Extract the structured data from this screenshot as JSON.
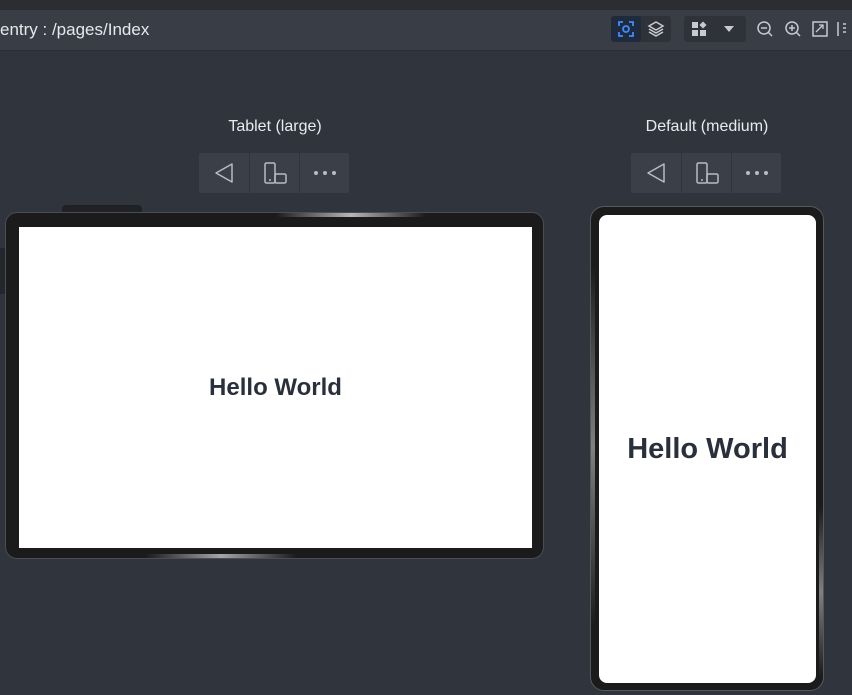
{
  "toolbar": {
    "title": "entry : /pages/Index"
  },
  "devices": {
    "tablet": {
      "label": "Tablet (large)",
      "content": "Hello World"
    },
    "default": {
      "label": "Default (medium)",
      "content": "Hello World"
    }
  },
  "icons": {
    "toolbar": [
      "inspect-icon",
      "layers-icon",
      "components-icon",
      "dropdown-icon",
      "zoom-out-icon",
      "zoom-in-icon",
      "fit-screen-icon",
      "ruler-icon"
    ],
    "device_controls": [
      "back-icon",
      "rotate-icon",
      "more-icon"
    ]
  },
  "colors": {
    "accent": "#3c8cff",
    "background": "#30343d",
    "toolbar": "#393d46"
  }
}
